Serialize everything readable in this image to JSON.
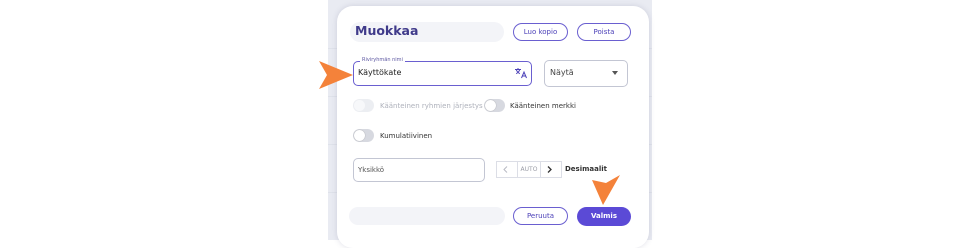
{
  "dialog": {
    "title": "Muokkaa",
    "copy_button": "Luo kopio",
    "delete_button": "Poista"
  },
  "row_group_name": {
    "label": "Riviryhmän nimi",
    "value": "Käyttökate"
  },
  "display_select": {
    "value": "Näytä"
  },
  "toggles": {
    "reverse_order": {
      "label": "Käänteinen ryhmien järjestys",
      "enabled": false,
      "on": false
    },
    "reverse_sign": {
      "label": "Käänteinen merkki",
      "enabled": true,
      "on": false
    },
    "cumulative": {
      "label": "Kumulatiivinen",
      "enabled": true,
      "on": false
    }
  },
  "unit": {
    "placeholder": "Yksikkö"
  },
  "decimals": {
    "value": "AUTO",
    "label": "Desimaalit"
  },
  "footer": {
    "cancel_button": "Peruuta",
    "done_button": "Valmis"
  },
  "colors": {
    "accent": "#5b4ad6",
    "pointer_arrow": "#f4823a"
  },
  "icons": {
    "translate": "translate-icon",
    "select_caret": "caret-down-icon",
    "prev": "chevron-left-icon",
    "next": "chevron-right-icon"
  }
}
